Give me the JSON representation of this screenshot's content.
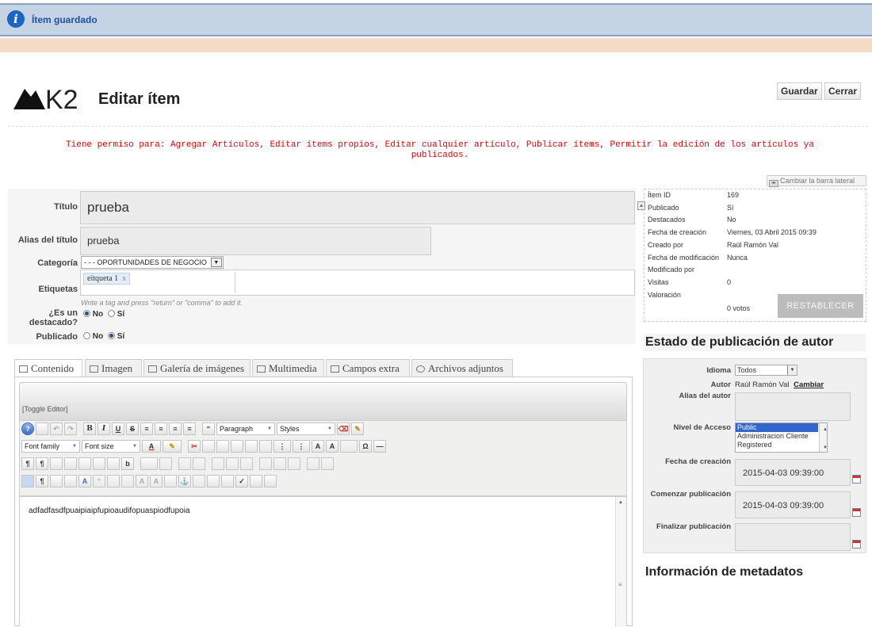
{
  "message": {
    "text": "Ítem guardado"
  },
  "header": {
    "title": "Editar ítem",
    "logo_text": "K2"
  },
  "toolbar": {
    "save_label": "Guardar",
    "close_label": "Cerrar"
  },
  "permissions": {
    "text": "Tiene permiso para: Agregar Artículos, Editar ítems propios, Editar cualquier artículo, Publicar ítems, Permitir la edición de los artículos ya publicados."
  },
  "sidebar_toggle": {
    "label": "Cambiar la barra lateral"
  },
  "form": {
    "title_label": "Título",
    "title_value": "prueba",
    "alias_label": "Alias del título",
    "alias_value": "prueba",
    "category_label": "Categoría",
    "category_value": "- - - OPORTUNIDADES DE NEGOCIO",
    "tags_label": "Etiquetas",
    "tag_chip": "eitqueta 1",
    "tag_remove": "x",
    "tags_hint": "Write a tag and press \"return\" or \"comma\" to add it.",
    "featured_label": "¿Es un destacado?",
    "featured_no": "No",
    "featured_yes": "Sí",
    "published_label": "Publicado",
    "published_no": "No",
    "published_yes": "Sí"
  },
  "meta": {
    "rows": [
      {
        "label": "Ítem ID",
        "value": "169"
      },
      {
        "label": "Publicado",
        "value": "Sí"
      },
      {
        "label": "Destacados",
        "value": "No"
      },
      {
        "label": "Fecha de creación",
        "value": "Viernes, 03 Abril 2015 09:39"
      },
      {
        "label": "Creado por",
        "value": "Raúl Ramón Val"
      },
      {
        "label": "Fecha de modificación",
        "value": "Nunca"
      },
      {
        "label": "Modificado por",
        "value": ""
      },
      {
        "label": "Visitas",
        "value": "0"
      },
      {
        "label": "Valoración",
        "value": ""
      }
    ],
    "votes": "0 votos",
    "reset_label": "RESTABLECER"
  },
  "publishing": {
    "section_title": "Estado de publicación de autor",
    "language_label": "Idioma",
    "language_value": "Todos",
    "author_label": "Autor",
    "author_value": "Raúl Ramón Val",
    "author_change": "Cambiar",
    "author_alias_label": "Alias del autor",
    "access_label": "Nivel de Acceso",
    "access_options": [
      "Public",
      "Administracion Cliente",
      "Registered"
    ],
    "created_label": "Fecha de creación",
    "created_value": "2015-04-03 09:39:00",
    "start_label": "Comenzar publicación",
    "start_value": "2015-04-03 09:39:00",
    "end_label": "Finalizar publicación",
    "end_value": ""
  },
  "metadata": {
    "section_title": "Información de metadatos"
  },
  "tabs": [
    {
      "label": "Contenido"
    },
    {
      "label": "Imagen"
    },
    {
      "label": "Galería de imágenes"
    },
    {
      "label": "Multimedia"
    },
    {
      "label": "Campos extra"
    },
    {
      "label": "Archivos adjuntos"
    }
  ],
  "editor": {
    "toggle_label": "[Toggle Editor]",
    "paragraph": "Paragraph",
    "styles": "Styles",
    "font_family": "Font family",
    "font_size": "Font size",
    "content": "adfadfasdfpuaipiaipfupioaudifopuaspiodfupoia"
  }
}
